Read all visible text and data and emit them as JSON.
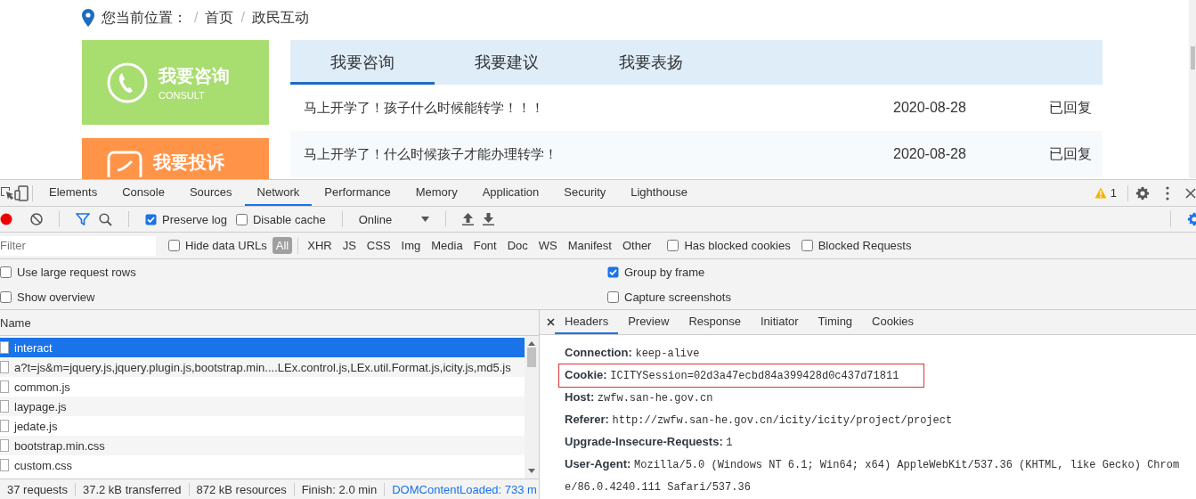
{
  "breadcrumb": {
    "label": "您当前位置：",
    "separator": "/",
    "items": [
      "首页",
      "政民互动"
    ]
  },
  "side_cards": [
    {
      "title": "我要咨询",
      "subtitle": "CONSULT",
      "color": "#a8dd6f"
    },
    {
      "title": "我要投诉",
      "color": "#ff9448"
    }
  ],
  "interaction_tabs": [
    {
      "label": "我要咨询",
      "selected": true
    },
    {
      "label": "我要建议",
      "selected": false
    },
    {
      "label": "我要表扬",
      "selected": false
    }
  ],
  "messages": [
    {
      "title": "马上开学了！孩子什么时候能转学！！！",
      "date": "2020-08-28",
      "status": "已回复"
    },
    {
      "title": "马上开学了！什么时候孩子才能办理转学！",
      "date": "2020-08-28",
      "status": "已回复"
    }
  ],
  "devtools": {
    "tabs": [
      {
        "label": "Elements",
        "selected": false
      },
      {
        "label": "Console",
        "selected": false
      },
      {
        "label": "Sources",
        "selected": false
      },
      {
        "label": "Network",
        "selected": true
      },
      {
        "label": "Performance",
        "selected": false
      },
      {
        "label": "Memory",
        "selected": false
      },
      {
        "label": "Application",
        "selected": false
      },
      {
        "label": "Security",
        "selected": false
      },
      {
        "label": "Lighthouse",
        "selected": false
      }
    ],
    "warning_count": "1"
  },
  "toolbar": {
    "recording": true,
    "checks": [
      {
        "label": "Preserve log",
        "checked": true
      },
      {
        "label": "Disable cache",
        "checked": false
      }
    ],
    "throttling": "Online"
  },
  "filter": {
    "placeholder": "Filter",
    "hide_data_urls": {
      "label": "Hide data URLs",
      "checked": false
    },
    "types": [
      {
        "label": "All",
        "selected": true
      },
      {
        "label": "XHR",
        "selected": false
      },
      {
        "label": "JS",
        "selected": false
      },
      {
        "label": "CSS",
        "selected": false
      },
      {
        "label": "Img",
        "selected": false
      },
      {
        "label": "Media",
        "selected": false
      },
      {
        "label": "Font",
        "selected": false
      },
      {
        "label": "Doc",
        "selected": false
      },
      {
        "label": "WS",
        "selected": false
      },
      {
        "label": "Manifest",
        "selected": false
      },
      {
        "label": "Other",
        "selected": false
      }
    ],
    "checks": [
      {
        "label": "Has blocked cookies",
        "checked": false
      },
      {
        "label": "Blocked Requests",
        "checked": false
      }
    ]
  },
  "options": [
    {
      "label": "Use large request rows",
      "checked": false
    },
    {
      "label": "Group by frame",
      "checked": true
    },
    {
      "label": "Show overview",
      "checked": false
    },
    {
      "label": "Capture screenshots",
      "checked": false
    }
  ],
  "requests": {
    "column": "Name",
    "rows": [
      {
        "name": "interact",
        "selected": true
      },
      {
        "name": "a?t=js&m=jquery.js,jquery.plugin.js,bootstrap.min....LEx.control.js,LEx.util.Format.js,icity.js,md5.js",
        "selected": false
      },
      {
        "name": "common.js",
        "selected": false
      },
      {
        "name": "laypage.js",
        "selected": false
      },
      {
        "name": "jedate.js",
        "selected": false
      },
      {
        "name": "bootstrap.min.css",
        "selected": false
      },
      {
        "name": "custom.css",
        "selected": false
      }
    ]
  },
  "detail": {
    "tabs": [
      {
        "label": "Headers",
        "selected": true
      },
      {
        "label": "Preview",
        "selected": false
      },
      {
        "label": "Response",
        "selected": false
      },
      {
        "label": "Initiator",
        "selected": false
      },
      {
        "label": "Timing",
        "selected": false
      },
      {
        "label": "Cookies",
        "selected": false
      }
    ],
    "headers": [
      {
        "name": "Connection:",
        "value": "keep-alive",
        "highlighted": false
      },
      {
        "name": "Cookie:",
        "value": "ICITYSession=02d3a47ecbd84a399428d0c437d71811",
        "highlighted": true
      },
      {
        "name": "Host:",
        "value": "zwfw.san-he.gov.cn",
        "highlighted": false
      },
      {
        "name": "Referer:",
        "value": "http://zwfw.san-he.gov.cn/icity/icity/project/project",
        "highlighted": false
      },
      {
        "name": "Upgrade-Insecure-Requests:",
        "value": "1",
        "highlighted": false
      },
      {
        "name": "User-Agent:",
        "value": "Mozilla/5.0 (Windows NT 6.1; Win64; x64) AppleWebKit/537.36 (KHTML, like Gecko) Chrome/86.0.4240.111 Safari/537.36",
        "highlighted": false
      }
    ]
  },
  "status_bar": [
    {
      "text": "37 requests",
      "kind": "stat"
    },
    {
      "text": "37.2 kB transferred",
      "kind": "stat"
    },
    {
      "text": "872 kB resources",
      "kind": "stat"
    },
    {
      "text": "Finish: 2.0 min",
      "kind": "stat"
    },
    {
      "text": "DOMContentLoaded: 733 m",
      "kind": "event"
    }
  ]
}
